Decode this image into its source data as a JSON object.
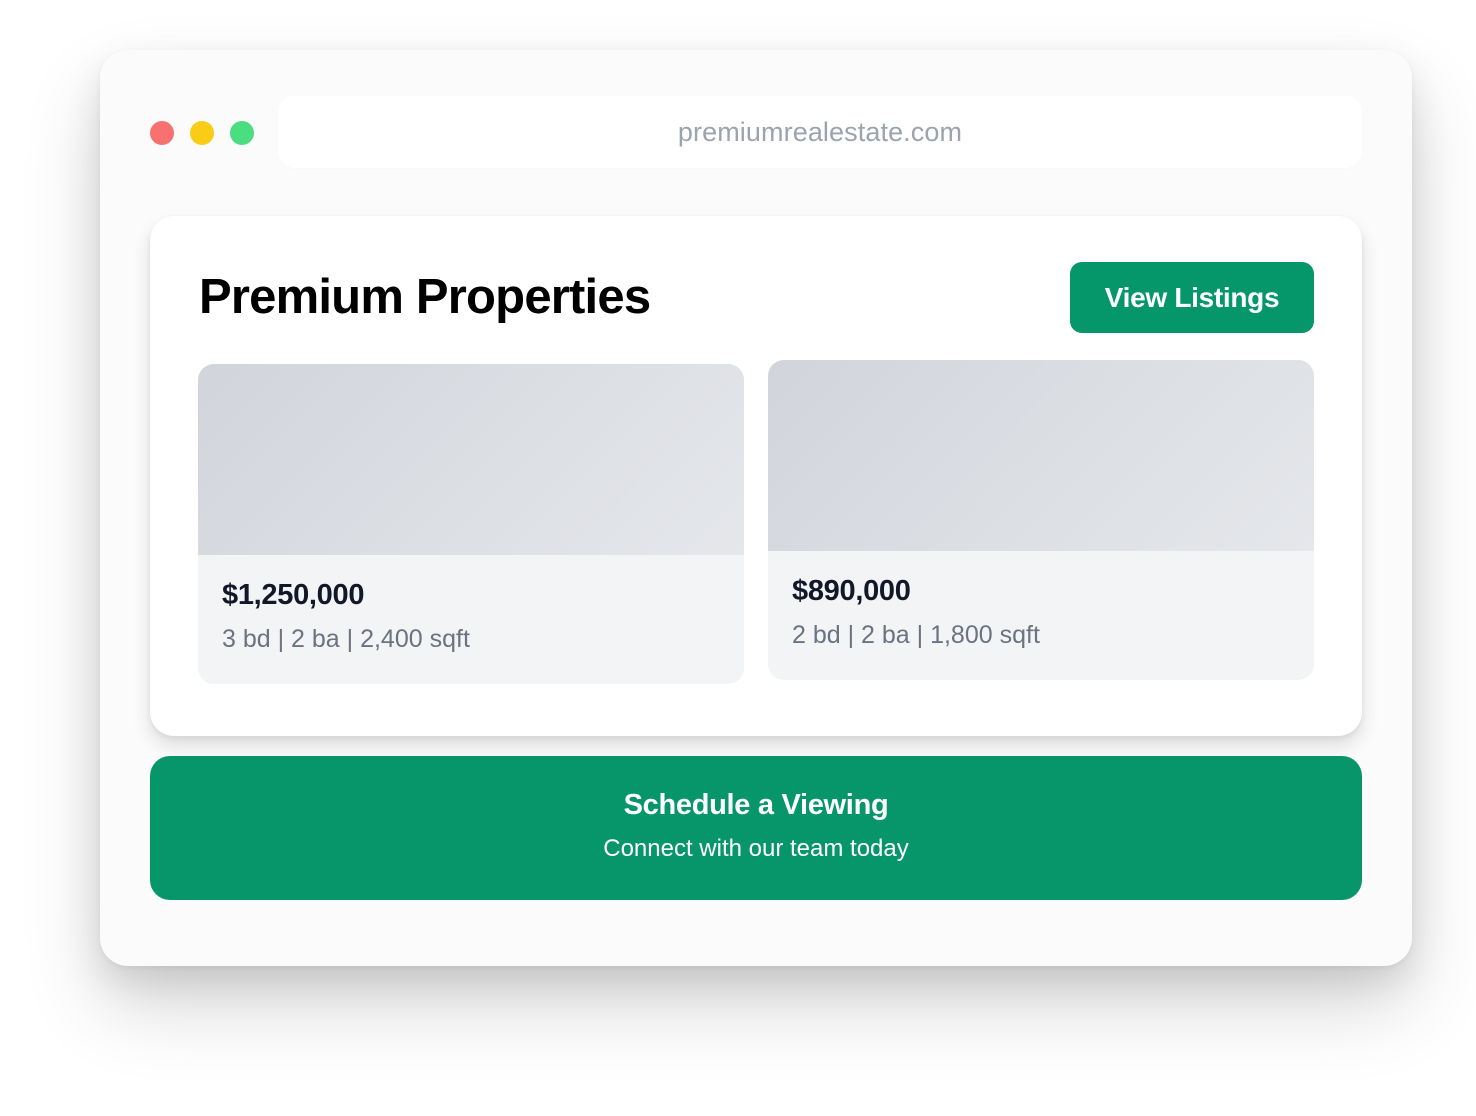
{
  "browser": {
    "url": "premiumrealestate.com",
    "traffic_lights": {
      "close_color": "#f87171",
      "minimize_color": "#facc15",
      "maximize_color": "#4ade80"
    }
  },
  "header": {
    "title": "Premium Properties",
    "view_listings_label": "View Listings"
  },
  "listings": [
    {
      "price": "$1,250,000",
      "specs": "3 bd | 2 ba | 2,400 sqft"
    },
    {
      "price": "$890,000",
      "specs": "2 bd | 2 ba | 1,800 sqft"
    }
  ],
  "cta": {
    "title": "Schedule a Viewing",
    "subtitle": "Connect with our team today"
  },
  "colors": {
    "accent": "#059669",
    "card_bg": "#f3f4f6",
    "price_text": "#111827",
    "specs_text": "#6b7280",
    "url_text": "#9ca3af"
  }
}
